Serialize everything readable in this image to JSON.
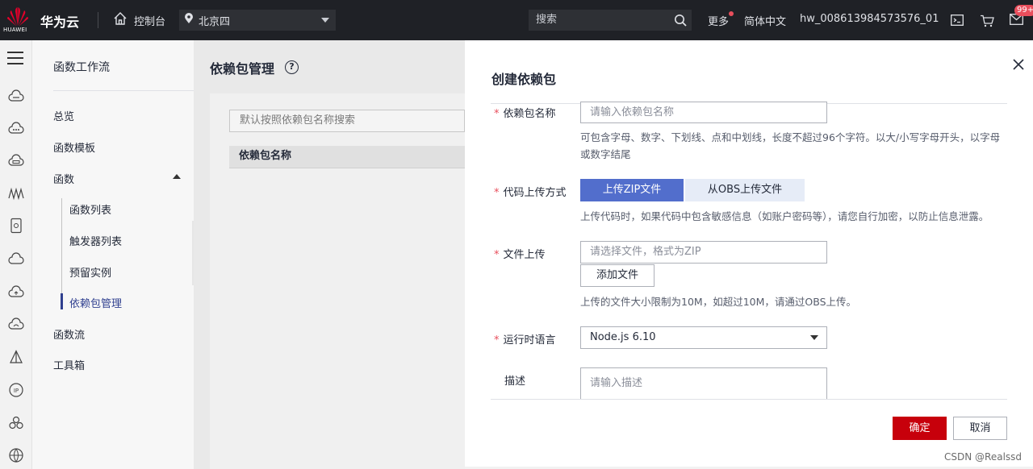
{
  "topbar": {
    "logo_text": "HUAWEI",
    "brand": "华为云",
    "console": "控制台",
    "region": "北京四",
    "search_placeholder": "搜索",
    "more": "更多",
    "language": "简体中文",
    "username": "hw_008613984573576_01",
    "badge": "99+"
  },
  "nav": {
    "title": "函数工作流",
    "items": [
      {
        "label": "总览"
      },
      {
        "label": "函数模板"
      },
      {
        "label": "函数"
      }
    ],
    "subitems": [
      {
        "label": "函数列表"
      },
      {
        "label": "触发器列表"
      },
      {
        "label": "预留实例"
      },
      {
        "label": "依赖包管理"
      }
    ],
    "items_after": [
      {
        "label": "函数流"
      },
      {
        "label": "工具箱"
      }
    ]
  },
  "main": {
    "title": "依赖包管理",
    "help": "?",
    "search_placeholder": "默认按照依赖包名称搜索",
    "column": "依赖包名称"
  },
  "drawer": {
    "title": "创建依赖包",
    "name_label": "依赖包名称",
    "name_placeholder": "请输入依赖包名称",
    "name_hint": "可包含字母、数字、下划线、点和中划线，长度不超过96个字符。以大/小写字母开头，以字母或数字结尾",
    "upload_mode_label": "代码上传方式",
    "upload_zip": "上传ZIP文件",
    "upload_obs": "从OBS上传文件",
    "upload_mode_hint": "上传代码时，如果代码中包含敏感信息（如账户密码等），请您自行加密，以防止信息泄露。",
    "file_label": "文件上传",
    "file_placeholder": "请选择文件，格式为ZIP",
    "add_file": "添加文件",
    "file_hint": "上传的文件大小限制为10M，如超过10M，请通过OBS上传。",
    "runtime_label": "运行时语言",
    "runtime_value": "Node.js 6.10",
    "desc_label": "描述",
    "desc_placeholder": "请输入描述",
    "ok": "确定",
    "cancel": "取消",
    "required_mark": "*"
  },
  "watermark": "CSDN @Realssd",
  "colors": {
    "topbar": "#1f2126",
    "primary_red": "#c7000b",
    "selected_blue": "#526ecc",
    "nav_active": "#2f3f8f"
  }
}
